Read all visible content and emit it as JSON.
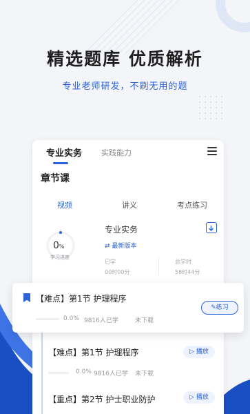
{
  "hero": {
    "title": "精选题库 优质解析",
    "subtitle": "专业老师研发，不刷无用的题"
  },
  "card": {
    "tabs": [
      {
        "label": "专业实务",
        "active": true
      },
      {
        "label": "实践能力",
        "active": false
      }
    ],
    "section_title": "章节课",
    "subtabs": [
      {
        "label": "视频",
        "active": true
      },
      {
        "label": "讲义",
        "active": false
      },
      {
        "label": "考点练习",
        "active": false
      }
    ],
    "progress": {
      "value": "0",
      "unit": "%",
      "label": "学习进度",
      "fraction": 0
    },
    "course": {
      "name": "专业实务",
      "version": "最新版本",
      "studied_label": "已学",
      "studied_value": "00时00分",
      "total_label": "总学时",
      "total_value": "58时44分"
    }
  },
  "lessons": [
    {
      "title": "【难点】第1节 护理程序",
      "percent": "0.0%",
      "learners": "9816人已学",
      "status": "未下载",
      "action": "练习"
    },
    {
      "title": "【难点】第1节 护理程序",
      "percent": "0.0%",
      "learners": "9816人已学",
      "status": "未下载",
      "action": "播放"
    },
    {
      "title": "【重点】第2节 护士职业防护",
      "action": "播放"
    }
  ],
  "colors": {
    "accent": "#2d63d8",
    "background": "#f3f5f9"
  }
}
